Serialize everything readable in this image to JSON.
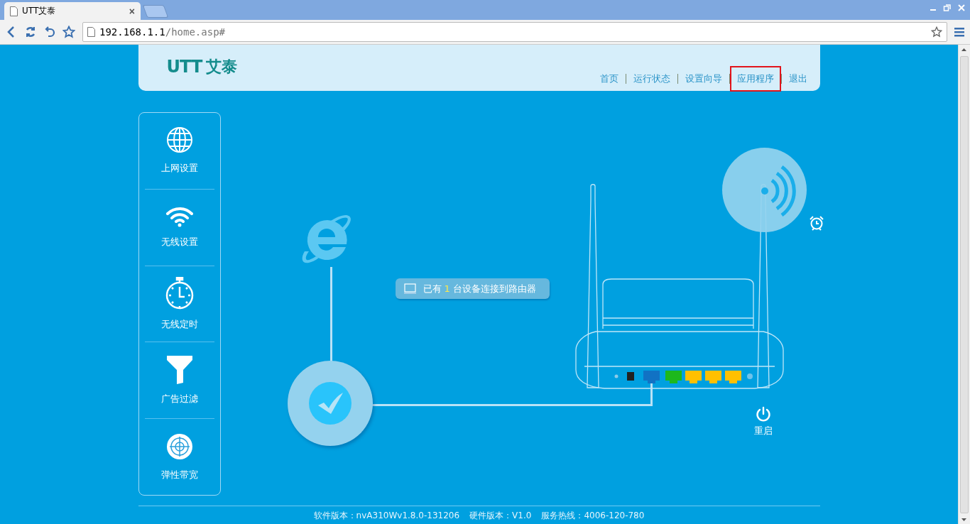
{
  "browser": {
    "tab": {
      "title": "UTT艾泰",
      "close": "×"
    },
    "address": {
      "host": "192.168.1.1",
      "path": "/home.asp#"
    }
  },
  "header": {
    "logo_mark": "UTT",
    "logo_text": "艾泰",
    "nav": [
      {
        "label": "首页",
        "highlighted": false
      },
      {
        "label": "运行状态",
        "highlighted": false
      },
      {
        "label": "设置向导",
        "highlighted": false
      },
      {
        "label": "应用程序",
        "highlighted": true
      },
      {
        "label": "退出",
        "highlighted": false
      }
    ]
  },
  "sidebar": {
    "items": [
      {
        "label": "上网设置"
      },
      {
        "label": "无线设置"
      },
      {
        "label": "无线定时"
      },
      {
        "label": "广告过滤"
      },
      {
        "label": "弹性带宽"
      }
    ]
  },
  "status": {
    "text_before": "已有",
    "count": "1",
    "text_after": "台设备连接到路由器"
  },
  "reboot": {
    "label": "重启"
  },
  "footer": [
    {
      "label": "软件版本：",
      "value": "nvA310Wv1.8.0-131206"
    },
    {
      "label": "硬件版本：",
      "value": "V1.0"
    },
    {
      "label": "服务热线：",
      "value": "4006-120-780"
    }
  ]
}
